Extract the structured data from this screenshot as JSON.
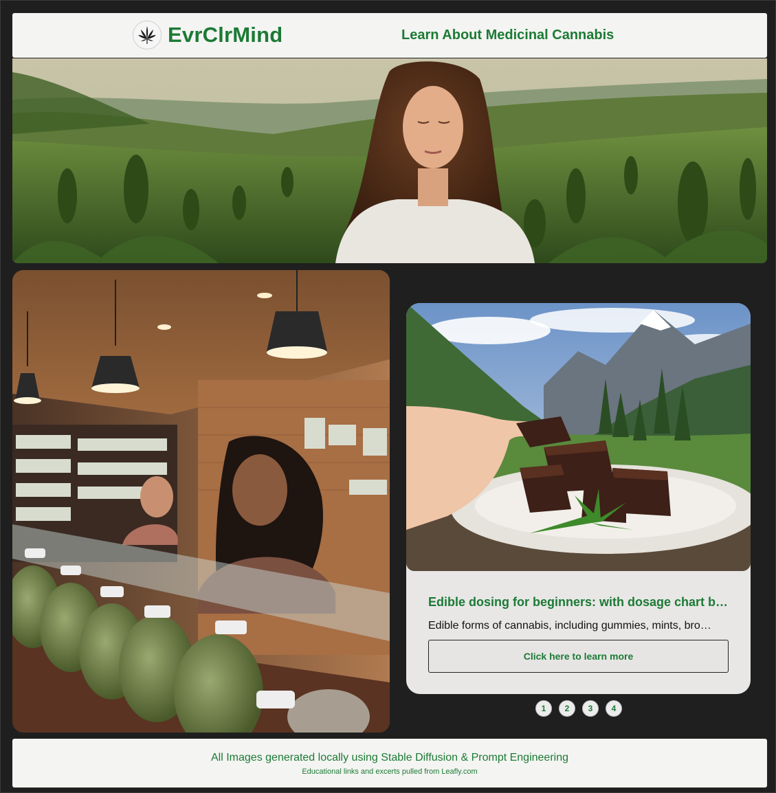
{
  "header": {
    "brand": "EvrClrMind",
    "nav_link": "Learn About Medicinal Cannabis"
  },
  "card": {
    "title": "Edible dosing for beginners: with dosage chart b…",
    "description": "Edible forms of cannabis, including gummies, mints, bro…",
    "button_label": "Click here to learn more"
  },
  "pagination": {
    "pages": [
      "1",
      "2",
      "3",
      "4"
    ],
    "current": "1"
  },
  "footer": {
    "main": "All Images generated locally using Stable Diffusion & Prompt Engineering",
    "sub": "Educational links and excerts pulled from Leafly.com"
  },
  "colors": {
    "brand_green": "#1c7a35",
    "page_bg": "#1f1f1f",
    "panel_bg": "#f4f4f2",
    "card_bg": "#e8e7e6"
  },
  "icons": {
    "logo": "cannabis-leaf-icon"
  }
}
